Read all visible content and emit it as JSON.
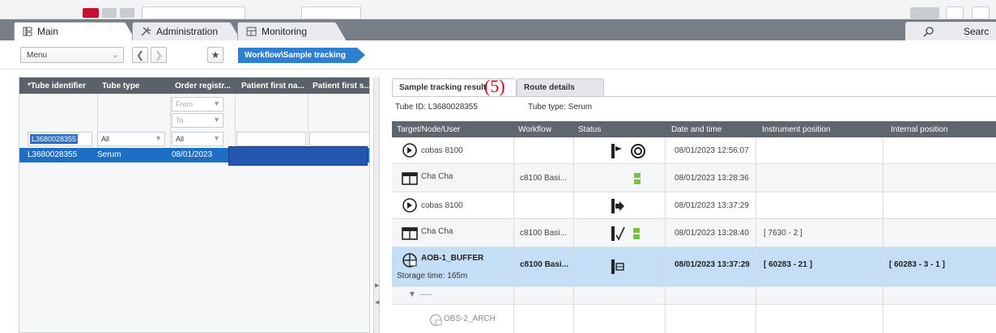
{
  "tabs": {
    "main": "Main",
    "administration": "Administration",
    "monitoring": "Monitoring",
    "search": "Searc"
  },
  "toolbar": {
    "menu_value": "Menu",
    "breadcrumb": "Workflow\\Sample tracking"
  },
  "left_table": {
    "columns": [
      "*Tube identifier",
      "Tube type",
      "Order registr...",
      "Patient first na...",
      "Patient first s..."
    ],
    "filter": {
      "tube_identifier": "L3680028355",
      "tube_type": "All",
      "order_from": "From",
      "order_to": "To",
      "order_all": "All"
    },
    "row": {
      "tube_identifier": "L3680028355",
      "tube_type": "Serum",
      "order_registration": "08/01/2023"
    }
  },
  "right": {
    "tabs": [
      "Sample tracking result",
      "Route details"
    ],
    "annotation": "(5)",
    "tube_id_label": "Tube ID: L3680028355",
    "tube_type_label": "Tube type: Serum",
    "columns": [
      "Target/Node/User",
      "Workflow",
      "Status",
      "Date and time",
      "Instrument position",
      "Internal position"
    ],
    "rows": [
      {
        "node": "cobas 8100",
        "workflow": "",
        "datetime": "08/01/2023 12:56:07",
        "instrument": "",
        "internal": ""
      },
      {
        "node": "Cha Cha",
        "workflow": "c8100 Basi...",
        "datetime": "08/01/2023 13:28:36",
        "instrument": "",
        "internal": ""
      },
      {
        "node": "cobas 8100",
        "workflow": "",
        "datetime": "08/01/2023 13:37:29",
        "instrument": "",
        "internal": ""
      },
      {
        "node": "Cha Cha",
        "workflow": "c8100 Basi...",
        "datetime": "08/01/2023 13:28:40",
        "instrument": "[ 7630 - 2 ]",
        "internal": ""
      },
      {
        "node": "AOB-1_BUFFER",
        "sub": "Storage time: 165m",
        "workflow": "c8100 Basi...",
        "datetime": "08/01/2023 13:37:29",
        "instrument": "[ 60283 - 21 ]",
        "internal": "[ 60283 - 3 - 1 ]"
      }
    ],
    "last_node": "OBS-2_ARCH"
  },
  "colors": {
    "breadcrumb": "#2f7fd0",
    "selected_row": "#1d6fc4",
    "highlight_row": "#c4dff5",
    "annotation": "#d0021b"
  }
}
